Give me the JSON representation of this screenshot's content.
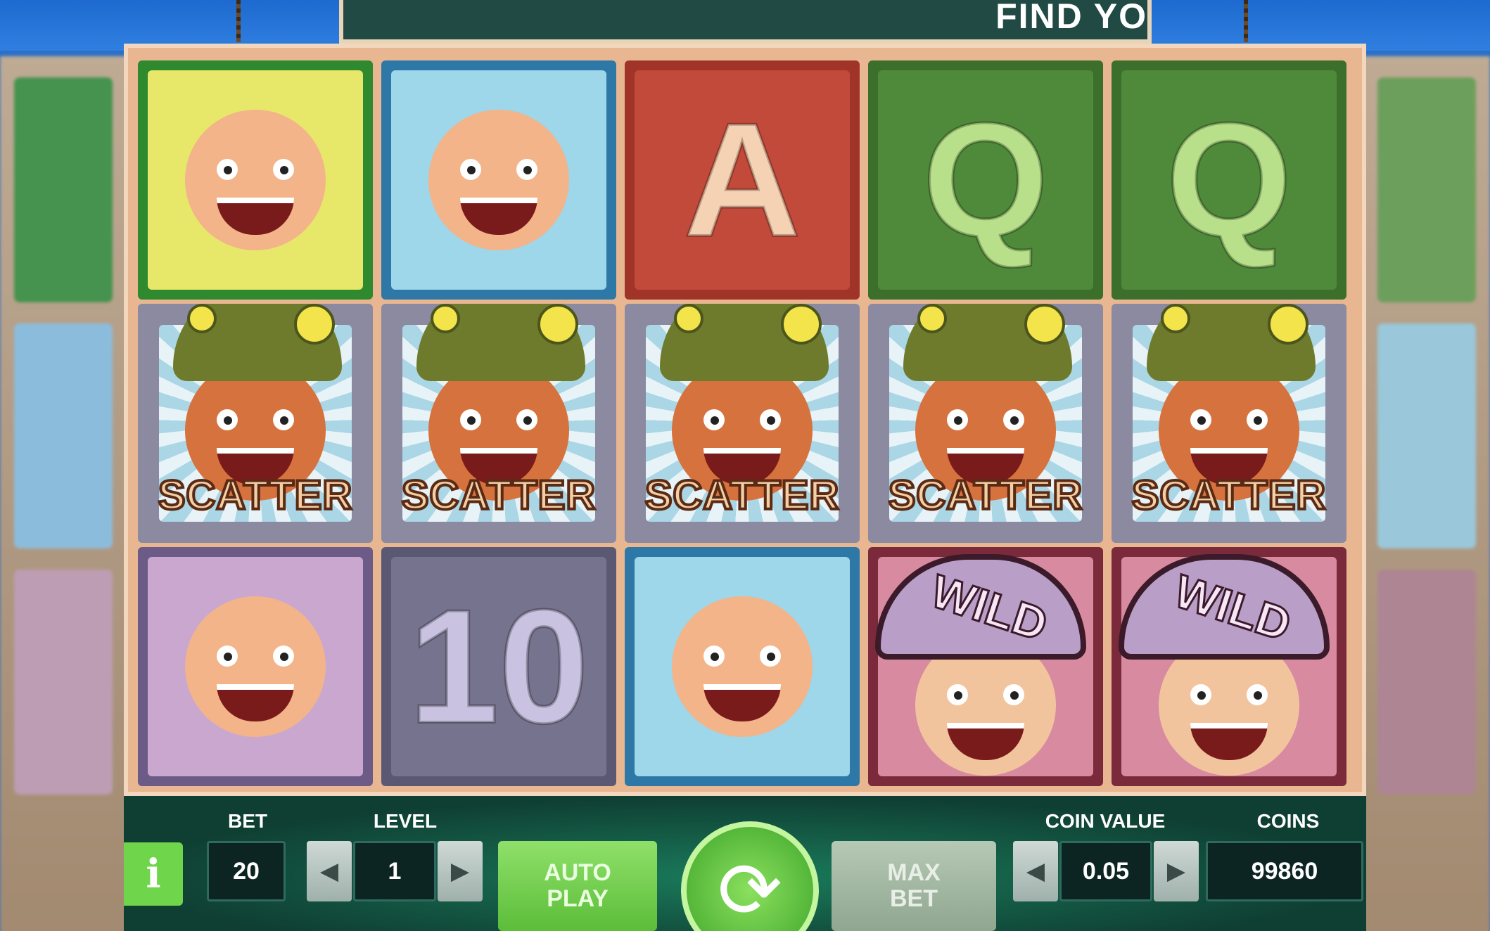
{
  "banner": {
    "text": "FIND YO"
  },
  "reels": [
    {
      "cells": [
        {
          "type": "character",
          "icon": "nurse-character-icon",
          "bg": "#e7e86a",
          "frame": "#2f8a2f"
        },
        {
          "type": "scatter",
          "label": "SCATTER"
        },
        {
          "type": "character",
          "icon": "fat-pirate-eyepatch-icon",
          "bg": "#c9a7cf",
          "frame": "#6b5b86"
        }
      ]
    },
    {
      "cells": [
        {
          "type": "character",
          "icon": "duck-hat-boy-icon",
          "bg": "#9ed6ea",
          "frame": "#2e78a8"
        },
        {
          "type": "scatter",
          "label": "SCATTER"
        },
        {
          "type": "letter",
          "label": "10",
          "icon": "ten-card-icon",
          "bg": "#76738f",
          "frame": "#5b5873",
          "color": "#c9c2e0"
        }
      ]
    },
    {
      "cells": [
        {
          "type": "letter",
          "label": "A",
          "icon": "ace-card-icon",
          "bg": "#c24a3b",
          "frame": "#a13428",
          "color": "#f4d2b3"
        },
        {
          "type": "scatter",
          "label": "SCATTER"
        },
        {
          "type": "character",
          "icon": "duck-hat-boy-icon",
          "bg": "#9ed6ea",
          "frame": "#2e78a8"
        }
      ]
    },
    {
      "cells": [
        {
          "type": "letter",
          "label": "Q",
          "icon": "queen-card-icon",
          "bg": "#4f8a3b",
          "frame": "#3c6f2c",
          "color": "#b8e08a"
        },
        {
          "type": "scatter",
          "label": "SCATTER"
        },
        {
          "type": "wild",
          "label": "WILD",
          "icon": "pirate-captain-wild-icon",
          "bg": "#d88aa0",
          "frame": "#7a2a3a"
        }
      ]
    },
    {
      "cells": [
        {
          "type": "letter",
          "label": "Q",
          "icon": "queen-card-icon",
          "bg": "#4f8a3b",
          "frame": "#3c6f2c",
          "color": "#b8e08a"
        },
        {
          "type": "scatter",
          "label": "SCATTER"
        },
        {
          "type": "wild",
          "label": "WILD",
          "icon": "pirate-captain-wild-icon",
          "bg": "#d88aa0",
          "frame": "#7a2a3a"
        }
      ]
    }
  ],
  "controls": {
    "info_label": "i",
    "bet_label": "BET",
    "bet_value": "20",
    "level_label": "LEVEL",
    "level_value": "1",
    "auto_play_label": "AUTO PLAY",
    "spin_icon": "spin-arrows-icon",
    "max_bet_label": "MAX BET",
    "coin_value_label": "COIN VALUE",
    "coin_value": "0.05",
    "coins_label": "COINS",
    "coins_value": "99860"
  }
}
